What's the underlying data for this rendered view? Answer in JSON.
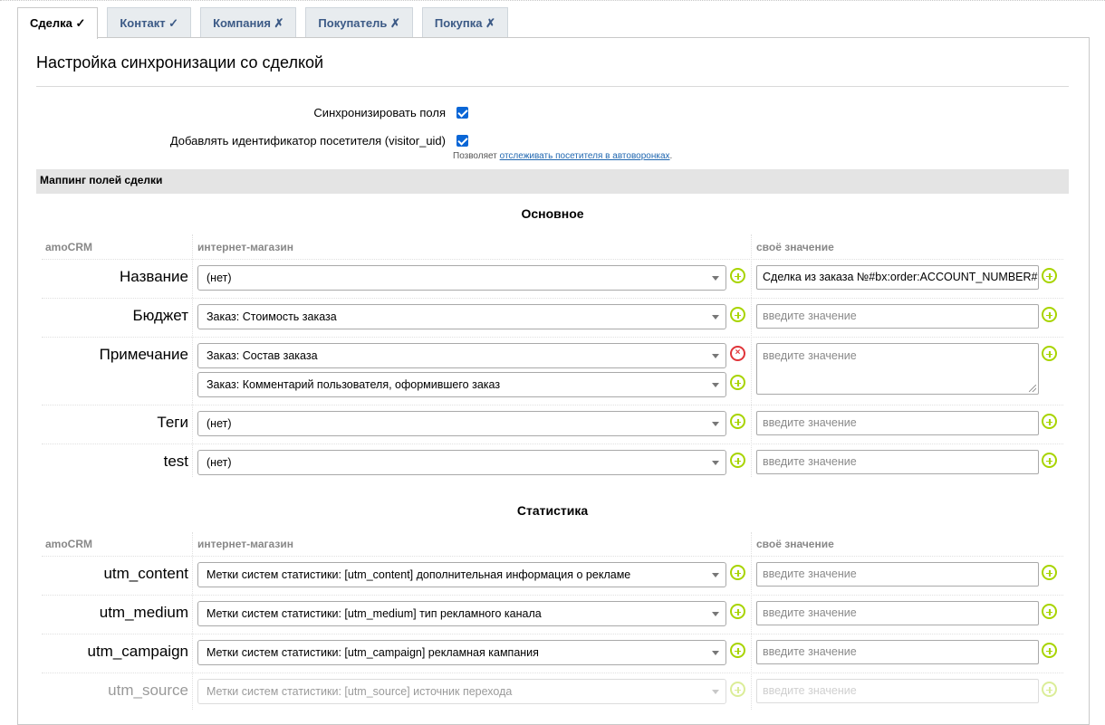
{
  "tabs": [
    {
      "label": "Сделка ✓"
    },
    {
      "label": "Контакт ✓"
    },
    {
      "label": "Компания ✗"
    },
    {
      "label": "Покупатель ✗"
    },
    {
      "label": "Покупка ✗"
    }
  ],
  "heading": "Настройка синхронизации со сделкой",
  "options": {
    "sync_label": "Синхронизировать поля",
    "sync_checked": true,
    "visitor_label": "Добавлять идентификатор посетителя (visitor_uid)",
    "visitor_checked": true,
    "hint_prefix": "Позволяет ",
    "hint_link": "отслеживать посетителя в автоворонках",
    "hint_suffix": "."
  },
  "mapping_title": "Маппинг полей сделки",
  "columns": {
    "amocrm": "amoCRM",
    "shop": "интернет-магазин",
    "own": "своё значение"
  },
  "groups": [
    {
      "title": "Основное",
      "rows": [
        {
          "label": "Название",
          "selects": [
            "(нет)"
          ],
          "value": "Сделка из заказа №#bx:order:ACCOUNT_NUMBER#",
          "placeholder": ""
        },
        {
          "label": "Бюджет",
          "selects": [
            "Заказ: Стоимость заказа"
          ],
          "value": "",
          "placeholder": "введите значение"
        },
        {
          "label": "Примечание",
          "selects": [
            "Заказ: Состав заказа",
            "Заказ: Комментарий пользователя, оформившего заказ"
          ],
          "value": "",
          "placeholder": "введите значение"
        },
        {
          "label": "Теги",
          "selects": [
            "(нет)"
          ],
          "value": "",
          "placeholder": "введите значение"
        },
        {
          "label": "test",
          "selects": [
            "(нет)"
          ],
          "value": "",
          "placeholder": "введите значение"
        }
      ]
    },
    {
      "title": "Статистика",
      "rows": [
        {
          "label": "utm_content",
          "selects": [
            "Метки систем статистики: [utm_content] дополнительная информация о рекламе"
          ],
          "value": "",
          "placeholder": "введите значение"
        },
        {
          "label": "utm_medium",
          "selects": [
            "Метки систем статистики: [utm_medium] тип рекламного канала"
          ],
          "value": "",
          "placeholder": "введите значение"
        },
        {
          "label": "utm_campaign",
          "selects": [
            "Метки систем статистики: [utm_campaign] рекламная кампания"
          ],
          "value": "",
          "placeholder": "введите значение"
        },
        {
          "label": "utm_source",
          "selects": [
            "Метки систем статистики: [utm_source] источник перехода"
          ],
          "value": "",
          "placeholder": "введите значение"
        }
      ]
    }
  ],
  "colors": {
    "accent_plus": "#a8d400",
    "remove": "#e0353a",
    "checkbox": "#0a66d6",
    "tab_link": "#3c5a86"
  }
}
